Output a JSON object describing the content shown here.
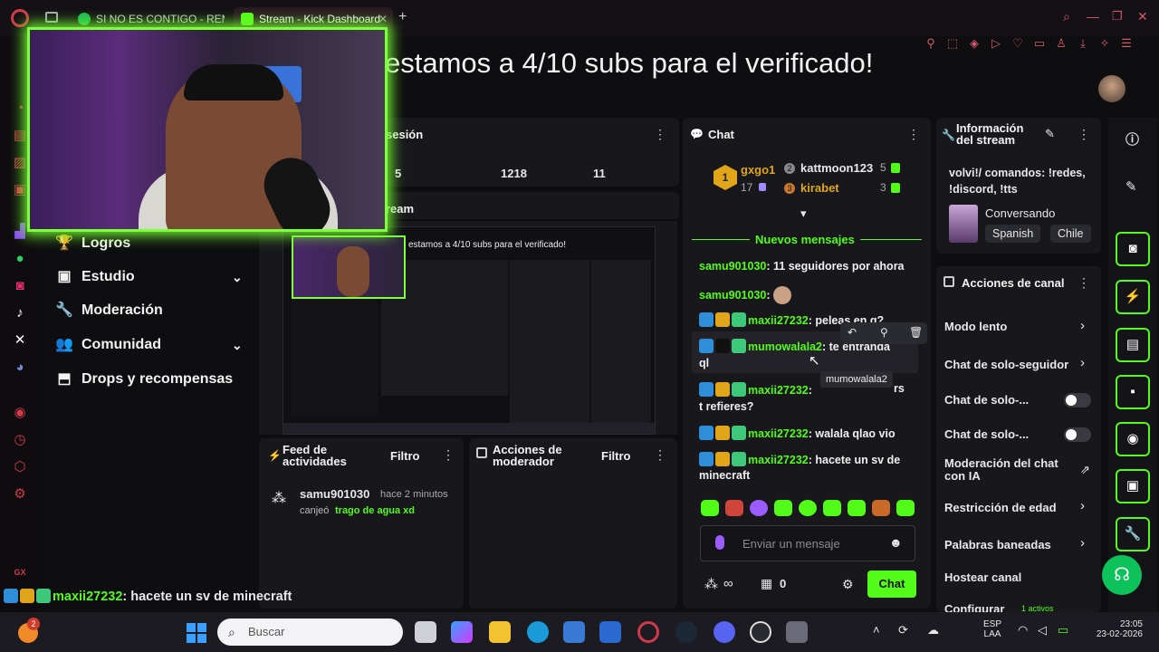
{
  "browser": {
    "tabs": [
      {
        "label": "SI NO ES CONTIGO - REM"
      },
      {
        "label": "Stream - Kick Dashboard"
      }
    ],
    "new_tab_icon": "plus-icon"
  },
  "header": {
    "overlay_message": "estamos a 4/10 subs para el verificado!"
  },
  "left_nav": {
    "items": [
      {
        "label": "Logros",
        "icon": "trophy-icon"
      },
      {
        "label": "Estudio",
        "icon": "studio-icon"
      },
      {
        "label": "Moderación",
        "icon": "wrench-icon"
      },
      {
        "label": "Comunidad",
        "icon": "people-icon"
      },
      {
        "label": "Drops y recompensas",
        "icon": "drops-icon"
      }
    ]
  },
  "session_panel": {
    "title": "sesión",
    "stats": [
      "5",
      "1218",
      "11"
    ]
  },
  "stream_panel": {
    "title": "ream"
  },
  "activity_feed": {
    "title": "Feed de actividades",
    "filter_label": "Filtro",
    "entry_user": "samu901030",
    "entry_time": "hace 2 minutos",
    "entry_action": "canjeó",
    "entry_reward": "trago de agua xd"
  },
  "mod_actions": {
    "title": "Acciones de moderador",
    "filter_label": "Filtro"
  },
  "chat": {
    "title": "Chat",
    "leaderboard": [
      {
        "rank": "1",
        "name": "gxgo1",
        "count": "17"
      },
      {
        "rank": "2",
        "name": "kattmoon123",
        "count": "5"
      },
      {
        "rank": "3",
        "name": "kirabet",
        "count": "3"
      }
    ],
    "new_messages_label": "Nuevos mensajes",
    "messages": [
      {
        "user": "samu901030",
        "text": ": 11 seguidores por ahora"
      },
      {
        "user": "samu901030",
        "text": ":"
      },
      {
        "user": "maxii27232",
        "text": ": peleas en g?"
      },
      {
        "user": "mumowalala2",
        "text": ": te entranda",
        "text2": "ql"
      },
      {
        "user": "maxii27232",
        "text": ":",
        "text_tail": "rs",
        "text2": "t refieres?"
      },
      {
        "user": "maxii27232",
        "text": ": walala qlao vio"
      },
      {
        "user": "maxii27232",
        "text": ": hacete un sv de",
        "text2": "minecraft"
      }
    ],
    "tooltip": "mumowalala2",
    "input_placeholder": "Enviar un mensaje",
    "points_value": "∞",
    "count_value": "0",
    "send_label": "Chat"
  },
  "stream_info": {
    "title": "Información del stream",
    "stream_title": "volvi!/ comandos: !redes, !discord, !tts",
    "category": "Conversando",
    "tags": [
      "Spanish",
      "Chile"
    ]
  },
  "channel_actions": {
    "title": "Acciones de canal",
    "items": [
      {
        "label": "Modo lento"
      },
      {
        "label": "Chat de solo-seguidor"
      },
      {
        "label": "Chat de solo-..."
      },
      {
        "label": "Chat de solo-..."
      },
      {
        "label": "Moderación del chat con IA"
      },
      {
        "label": "Restricción de edad"
      },
      {
        "label": "Palabras baneadas"
      },
      {
        "label": "Hostear canal"
      },
      {
        "label": "Configurar"
      }
    ],
    "footer_note": "1 activos"
  },
  "ticker": {
    "user": "maxii27232",
    "text": ": hacete un sv de minecraft"
  },
  "taskbar": {
    "search_placeholder": "Buscar",
    "notification_count": "2",
    "language": "ESP",
    "layout": "LAA",
    "time": "23:05",
    "date": "23-02-2026"
  },
  "colors": {
    "kick_green": "#53fc18",
    "opera_red": "#d23a4a",
    "panel": "#18181c"
  }
}
